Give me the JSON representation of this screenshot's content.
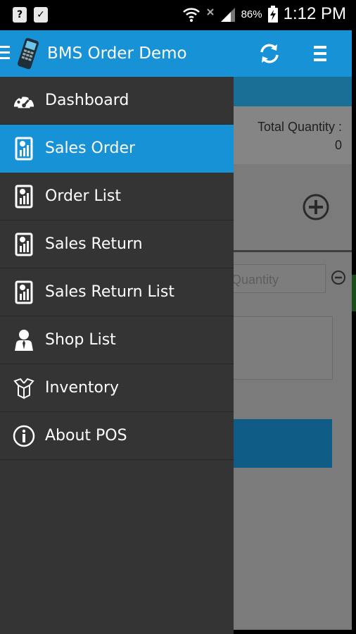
{
  "status_bar": {
    "left_icons": [
      "sim-unknown-icon",
      "clipboard-check-icon"
    ],
    "right_icons": [
      "wifi-icon",
      "no-signal-icon",
      "signal-icon",
      "battery-charging-icon"
    ],
    "battery": "86%",
    "time": "1:12 PM"
  },
  "app_bar": {
    "title": "BMS Order Demo",
    "icons": [
      "hamburger-icon",
      "pos-terminal-icon",
      "refresh-icon",
      "overflow-menu-icon"
    ],
    "color": "#1792d6"
  },
  "drawer": {
    "items": [
      {
        "label": "Dashboard",
        "icon": "dashboard-gauge-icon",
        "active": false
      },
      {
        "label": "Sales Order",
        "icon": "report-icon",
        "active": true
      },
      {
        "label": "Order List",
        "icon": "report-icon",
        "active": false
      },
      {
        "label": "Sales Return",
        "icon": "report-icon",
        "active": false
      },
      {
        "label": "Sales Return List",
        "icon": "report-icon",
        "active": false
      },
      {
        "label": "Shop List",
        "icon": "person-icon",
        "active": false
      },
      {
        "label": "Inventory",
        "icon": "box-icon",
        "active": false
      },
      {
        "label": "About POS",
        "icon": "info-icon",
        "active": false
      }
    ],
    "background": "#343434",
    "active_color": "#1792d6"
  },
  "background_screen": {
    "total_quantity_label": "Total Quantity :",
    "total_quantity_value": "0",
    "quantity_placeholder": "Quantity"
  }
}
